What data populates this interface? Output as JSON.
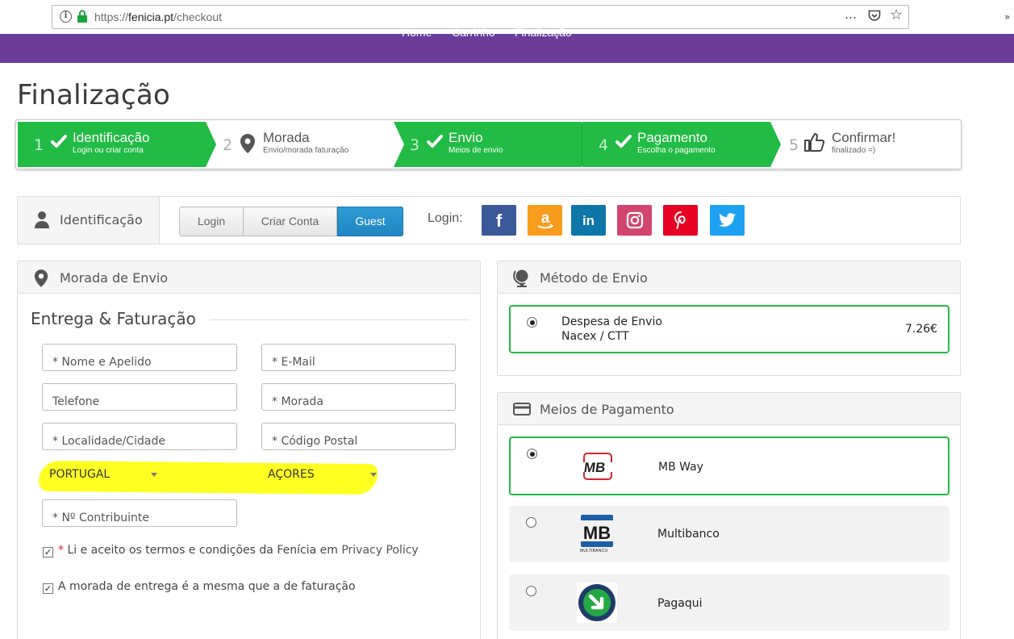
{
  "browser": {
    "url_prefix": "https://",
    "url_host": "fenicia.pt",
    "url_path": "/checkout",
    "more_icon": "…",
    "pocket_icon": "pocket-icon",
    "star_icon": "☆"
  },
  "nav": {
    "items": [
      "Home",
      "Carrinho",
      "Finalização"
    ]
  },
  "page": {
    "title": "Finalização"
  },
  "steps": [
    {
      "num": "1",
      "label": "Identificação",
      "sub": "Login ou criar conta",
      "icon": "check-icon",
      "state": "done"
    },
    {
      "num": "2",
      "label": "Morada",
      "sub": "Envio/morada faturação",
      "icon": "location-pin-icon",
      "state": "pending"
    },
    {
      "num": "3",
      "label": "Envio",
      "sub": "Meios de envio",
      "icon": "check-icon",
      "state": "done"
    },
    {
      "num": "4",
      "label": "Pagamento",
      "sub": "Escolha o pagamento",
      "icon": "check-icon",
      "state": "done"
    },
    {
      "num": "5",
      "label": "Confirmar!",
      "sub": "finalizado =)",
      "icon": "thumbs-up-icon",
      "state": "pending"
    }
  ],
  "identification": {
    "title": "Identificação",
    "tabs": [
      "Login",
      "Criar Conta",
      "Guest"
    ],
    "active_tab": "Guest",
    "login_label": "Login:",
    "social": [
      {
        "name": "facebook",
        "glyph": "f",
        "color": "#3b5998"
      },
      {
        "name": "amazon",
        "glyph": "a",
        "color": "#f79c1c"
      },
      {
        "name": "linkedin",
        "glyph": "in",
        "color": "#0e76a8"
      },
      {
        "name": "instagram",
        "glyph": "instagram",
        "color": "#d1456f"
      },
      {
        "name": "pinterest",
        "glyph": "P",
        "color": "#e60023"
      },
      {
        "name": "twitter",
        "glyph": "twitter",
        "color": "#1da1f2"
      }
    ]
  },
  "shipping": {
    "panel_title": "Morada de Envio",
    "section_title": "Entrega & Faturação",
    "fields": {
      "name": "* Nome e Apelido",
      "email": "* E-Mail",
      "phone": "Telefone",
      "address": "* Morada",
      "city": "* Localidade/Cidade",
      "postal": "* Código Postal",
      "nif": "* Nº Contribuinte"
    },
    "country": "PORTUGAL",
    "region": "AÇORES",
    "terms_required": "*",
    "terms_text": " Li e aceito os termos e condições da Fenícia em ",
    "terms_link": "Privacy Policy",
    "same_address": "A morada de entrega é a mesma que a de faturação"
  },
  "method": {
    "panel_title": "Método de Envio",
    "option_title": "Despesa de Envio",
    "option_sub": "Nacex / CTT",
    "price": "7.26€"
  },
  "payment": {
    "panel_title": "Meios de Pagamento",
    "options": [
      {
        "label": "MB Way",
        "logo": "mbway-logo"
      },
      {
        "label": "Multibanco",
        "logo": "multibanco-logo"
      },
      {
        "label": "Pagaqui",
        "logo": "pagaqui-logo"
      }
    ],
    "multibanco_logo_text": "MULTIBANCO"
  },
  "colors": {
    "nav": "#6b3d99",
    "step_green": "#21bb45",
    "active_tab": "#2188c3",
    "highlight": "#ffff22"
  }
}
